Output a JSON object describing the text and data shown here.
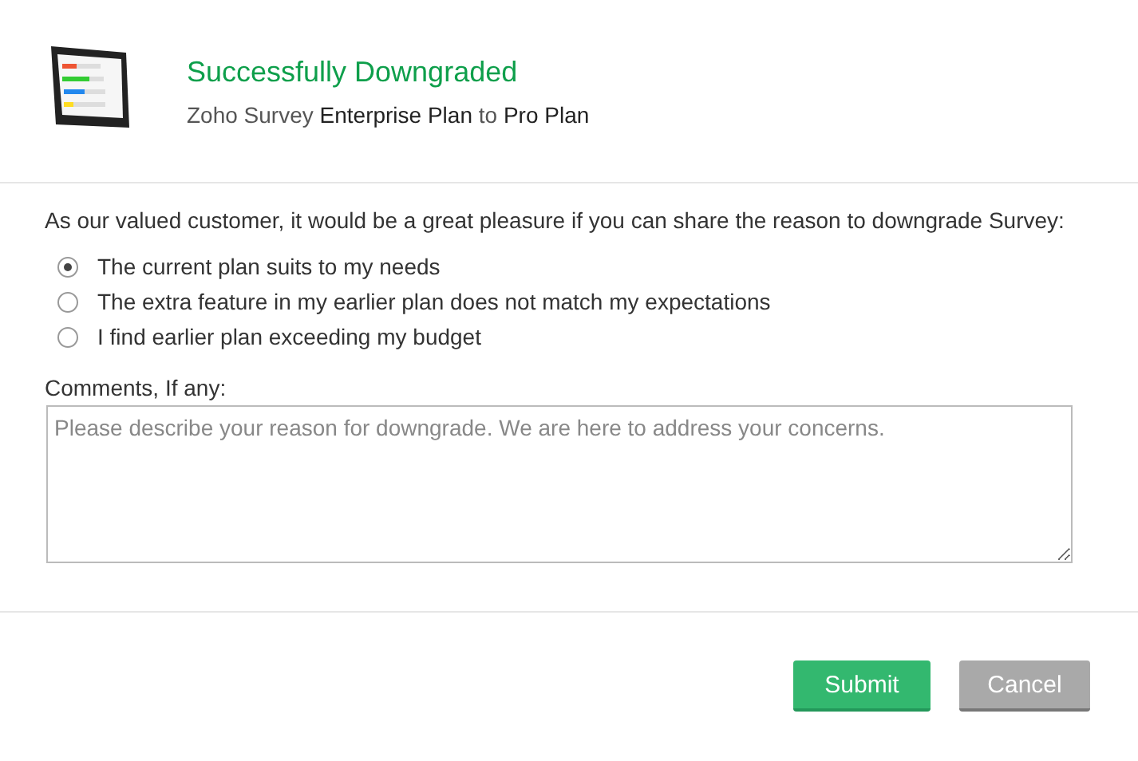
{
  "header": {
    "title": "Successfully Downgraded",
    "subtitle": "Zoho Survey **Enterprise Plan** to **Pro Plan**"
  },
  "question": "As our valued customer, it would be a great pleasure if you can share the reason to downgrade Survey:",
  "reasons": [
    {
      "label": "The current plan suits to my needs",
      "selected": true
    },
    {
      "label": "The extra feature in my earlier plan does not match my expectations",
      "selected": false
    },
    {
      "label": "I find earlier plan exceeding my budget",
      "selected": false
    }
  ],
  "comments": {
    "label": "Comments, If any:",
    "placeholder": "Please describe your reason for downgrade. We are here to address your concerns."
  },
  "buttons": [
    {
      "label": "Submit",
      "kind": "primary"
    },
    {
      "label": "Cancel",
      "kind": "secondary"
    }
  ]
}
